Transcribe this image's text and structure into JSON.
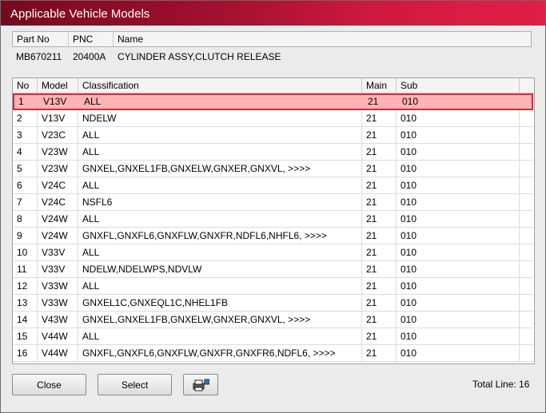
{
  "window": {
    "title": "Applicable Vehicle Models"
  },
  "info": {
    "headers": {
      "part_no": "Part No",
      "pnc": "PNC",
      "name": "Name"
    },
    "values": {
      "part_no": "MB670211",
      "pnc": "20400A",
      "name": "CYLINDER ASSY,CLUTCH RELEASE"
    }
  },
  "table": {
    "headers": {
      "no": "No",
      "model": "Model",
      "classification": "Classification",
      "main": "Main",
      "sub": "Sub"
    },
    "rows": [
      {
        "no": "1",
        "model": "V13V",
        "classification": "ALL",
        "main": "21",
        "sub": "010",
        "selected": true
      },
      {
        "no": "2",
        "model": "V13V",
        "classification": "NDELW",
        "main": "21",
        "sub": "010"
      },
      {
        "no": "3",
        "model": "V23C",
        "classification": "ALL",
        "main": "21",
        "sub": "010"
      },
      {
        "no": "4",
        "model": "V23W",
        "classification": "ALL",
        "main": "21",
        "sub": "010"
      },
      {
        "no": "5",
        "model": "V23W",
        "classification": "GNXEL,GNXEL1FB,GNXELW,GNXER,GNXVL,  >>>>",
        "main": "21",
        "sub": "010"
      },
      {
        "no": "6",
        "model": "V24C",
        "classification": "ALL",
        "main": "21",
        "sub": "010"
      },
      {
        "no": "7",
        "model": "V24C",
        "classification": "NSFL6",
        "main": "21",
        "sub": "010"
      },
      {
        "no": "8",
        "model": "V24W",
        "classification": "ALL",
        "main": "21",
        "sub": "010"
      },
      {
        "no": "9",
        "model": "V24W",
        "classification": "GNXFL,GNXFL6,GNXFLW,GNXFR,NDFL6,NHFL6,  >>>>",
        "main": "21",
        "sub": "010"
      },
      {
        "no": "10",
        "model": "V33V",
        "classification": "ALL",
        "main": "21",
        "sub": "010"
      },
      {
        "no": "11",
        "model": "V33V",
        "classification": "NDELW,NDELWPS,NDVLW",
        "main": "21",
        "sub": "010"
      },
      {
        "no": "12",
        "model": "V33W",
        "classification": "ALL",
        "main": "21",
        "sub": "010"
      },
      {
        "no": "13",
        "model": "V33W",
        "classification": "GNXEL1C,GNXEQL1C,NHEL1FB",
        "main": "21",
        "sub": "010"
      },
      {
        "no": "14",
        "model": "V43W",
        "classification": "GNXEL,GNXEL1FB,GNXELW,GNXER,GNXVL,  >>>>",
        "main": "21",
        "sub": "010"
      },
      {
        "no": "15",
        "model": "V44W",
        "classification": "ALL",
        "main": "21",
        "sub": "010"
      },
      {
        "no": "16",
        "model": "V44W",
        "classification": "GNXFL,GNXFL6,GNXFLW,GNXFR,GNXFR6,NDFL6,  >>>>",
        "main": "21",
        "sub": "010"
      }
    ]
  },
  "footer": {
    "close_label": "Close",
    "select_label": "Select",
    "print_icon": "printer-icon",
    "total_label": "Total Line: 16"
  },
  "colors": {
    "title_dark": "#76091d",
    "title_light": "#e01e46",
    "selected_fill": "#ffb3b3",
    "selected_border": "#d62a3a"
  }
}
